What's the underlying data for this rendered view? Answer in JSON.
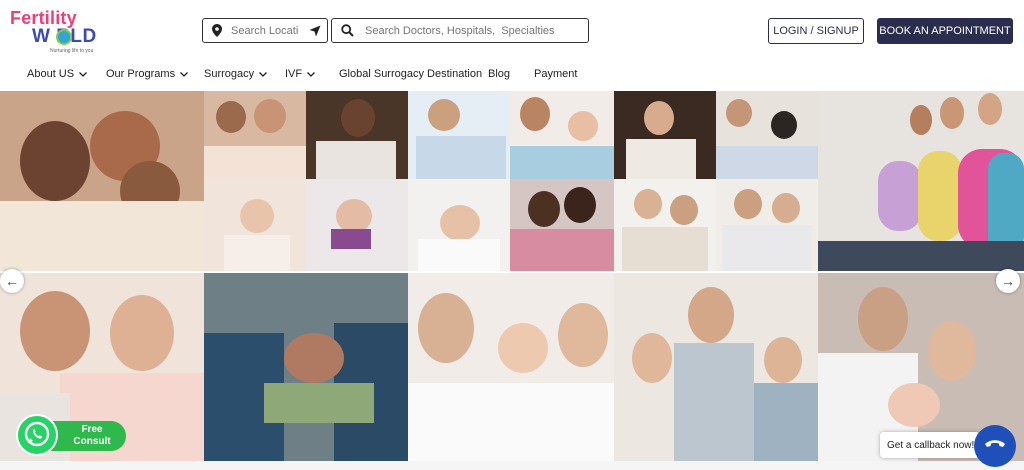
{
  "brand": {
    "line1": "Fertility",
    "line2": "W  RLD",
    "tagline": "Nurturing life to you"
  },
  "search": {
    "location_placeholder": "Search Location",
    "main_placeholder": "Search Doctors, Hospitals,  Specialties"
  },
  "header_buttons": {
    "login": "LOGIN / SIGNUP",
    "book": "BOOK AN APPOINTMENT"
  },
  "nav": {
    "items": [
      {
        "label": "About US",
        "has_dropdown": true
      },
      {
        "label": "Our Programs",
        "has_dropdown": true
      },
      {
        "label": "Surrogacy",
        "has_dropdown": true
      },
      {
        "label": "IVF",
        "has_dropdown": true
      },
      {
        "label": "Global Surrogacy Destination",
        "has_dropdown": false
      },
      {
        "label": "Blog",
        "has_dropdown": false
      },
      {
        "label": "Payment",
        "has_dropdown": false
      }
    ]
  },
  "carousel": {
    "prev": "←",
    "next": "→"
  },
  "widgets": {
    "consult_line1": "Free",
    "consult_line2": "Consult",
    "callback": "Get a callback now!"
  },
  "colors": {
    "brand_pink": "#e8407a",
    "brand_blue": "#3b4bb5",
    "navy_button": "#2b2d4f",
    "whatsapp_green": "#25d366",
    "call_blue": "#1f4fb8"
  }
}
